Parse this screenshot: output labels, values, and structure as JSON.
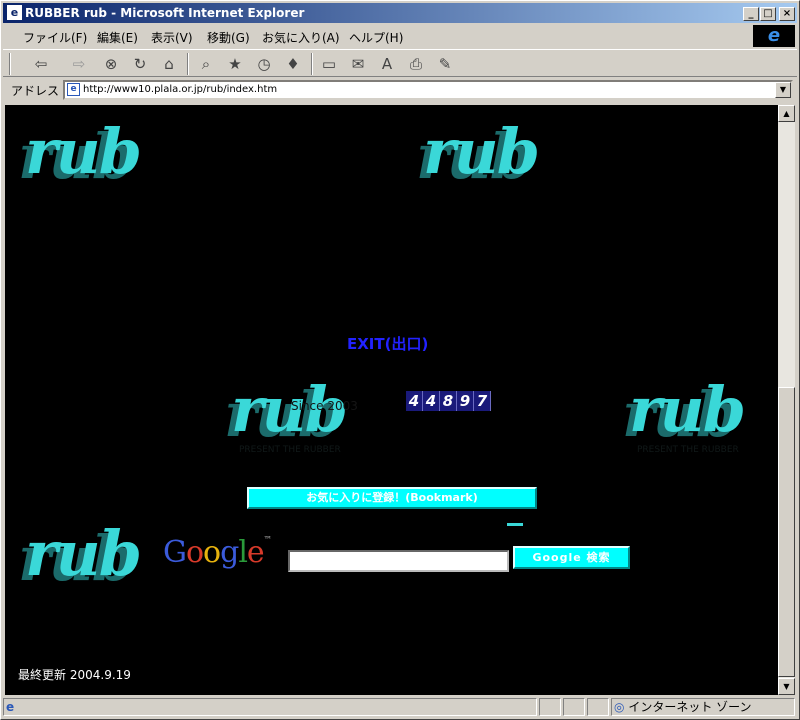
{
  "window": {
    "title": "RUBBER rub - Microsoft Internet Explorer",
    "app_icon": "e",
    "min_glyph": "_",
    "max_glyph": "□",
    "close_glyph": "×"
  },
  "menu": [
    "ファイル(F)",
    "編集(E)",
    "表示(V)",
    "移動(G)",
    "お気に入り(A)",
    "ヘルプ(H)"
  ],
  "toolbar_icons": [
    "back-icon",
    "forward-icon",
    "stop-icon",
    "refresh-icon",
    "home-icon",
    "search-icon",
    "favorites-icon",
    "history-icon",
    "channels-icon",
    "fullscreen-icon",
    "mail-icon",
    "font-icon",
    "print-icon",
    "edit-icon"
  ],
  "toolbar_glyphs": {
    "back": "⇦",
    "forward": "⇨",
    "stop": "⊗",
    "refresh": "↻",
    "home": "⌂",
    "search": "⌕",
    "favorites": "★",
    "history": "◷",
    "channels": "♦",
    "fullscreen": "▭",
    "mail": "✉",
    "font": "A",
    "print": "⎙",
    "edit": "✎"
  },
  "address": {
    "label": "アドレス",
    "url": "http://www10.plala.or.jp/rub/index.htm",
    "page_icon": "e",
    "dropdown_glyph": "▼"
  },
  "page": {
    "logo_text": "rub",
    "logo_subtext": "PRESENT THE RUBBER",
    "exit_link": "EXIT(出口)",
    "since_text": "Since 2003",
    "counter_digits": [
      "4",
      "4",
      "8",
      "9",
      "7"
    ],
    "bookmark_button": "お気に入りに登録！(Bookmark)",
    "google_tm": "™",
    "search_placeholder": "",
    "search_button": "Google 検索",
    "last_updated_label": "最終更新",
    "last_updated_date": "2004.9.19"
  },
  "scrollbar": {
    "up_glyph": "▲",
    "down_glyph": "▼"
  },
  "status": {
    "page_icon": "e",
    "zone_icon": "◎",
    "zone": "インターネット ゾーン"
  },
  "colors": {
    "page_background": "#000000",
    "logo": "#3ad8d8",
    "button_cyan": "#00ffff",
    "exit_link": "#2222ff",
    "titlebar_start": "#0a246a",
    "titlebar_end": "#a6caf0"
  }
}
